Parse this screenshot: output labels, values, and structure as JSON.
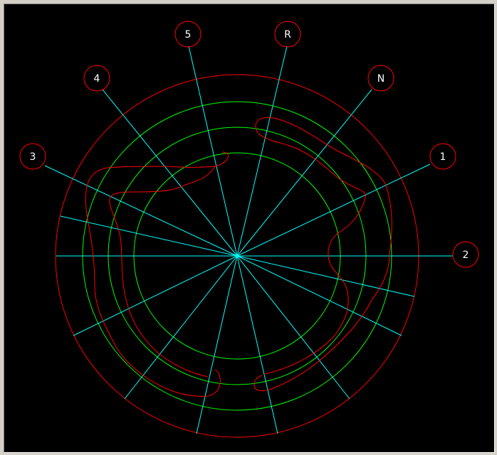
{
  "diagram": {
    "colors": {
      "background": "#000000",
      "outer_ring": "#ff0000",
      "track": "#00ff00",
      "rays": "#00ffff",
      "gate_path": "#ff0000",
      "label_circle": "#ff0000",
      "label_text": "#ffffff"
    },
    "position_labels": [
      "5",
      "R",
      "4",
      "N",
      "3",
      "1",
      "2"
    ]
  }
}
